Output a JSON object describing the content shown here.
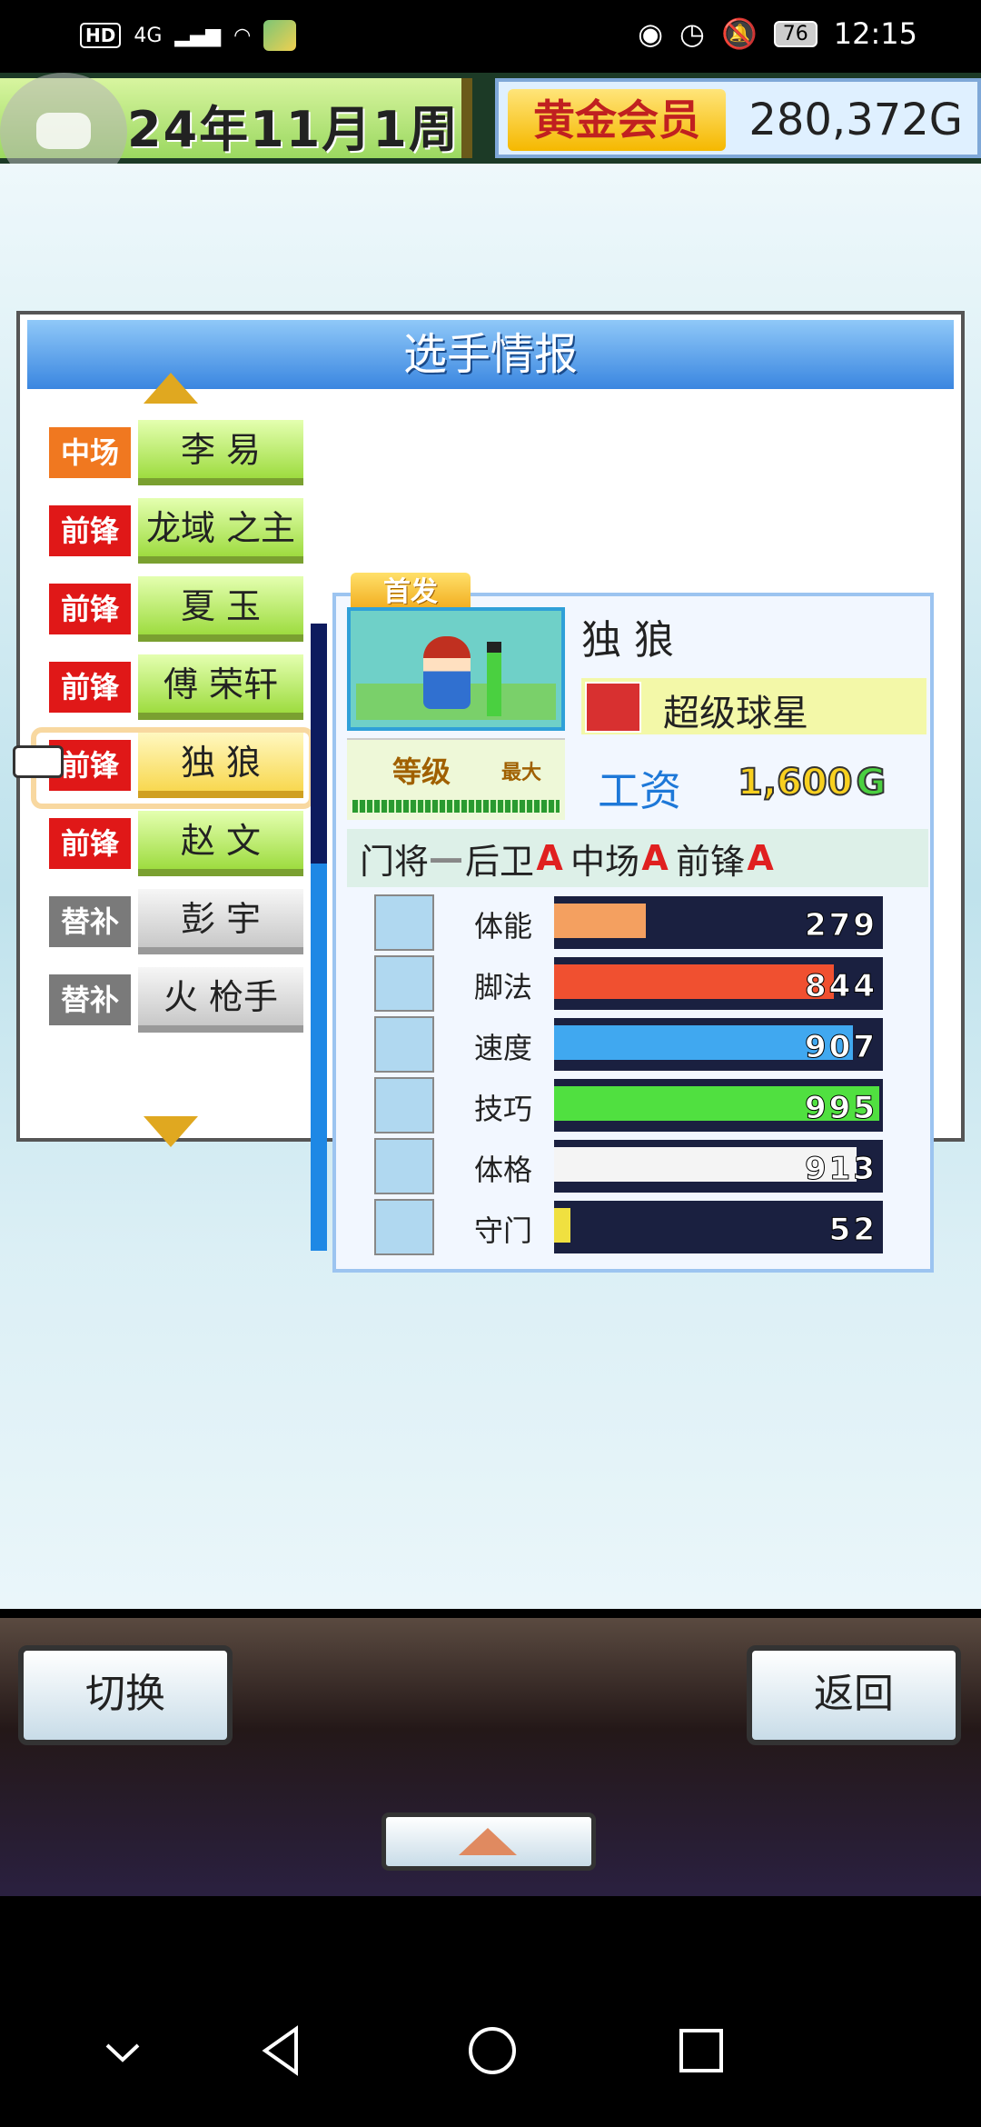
{
  "status_bar": {
    "hd": "HD",
    "network": "4G",
    "time": "12:15",
    "battery": "76"
  },
  "top_bar": {
    "date": "24年11月1周",
    "membership": "黄金会员",
    "gold": "280,372G"
  },
  "panel": {
    "title": "选手情报",
    "roster": [
      {
        "position": "中场",
        "name": "李 易",
        "position_color": "#f07820",
        "kind": "starter"
      },
      {
        "position": "前锋",
        "name": "龙域 之主",
        "position_color": "#e01818",
        "kind": "starter"
      },
      {
        "position": "前锋",
        "name": "夏 玉",
        "position_color": "#e01818",
        "kind": "starter"
      },
      {
        "position": "前锋",
        "name": "傅 荣轩",
        "position_color": "#e01818",
        "kind": "starter"
      },
      {
        "position": "前锋",
        "name": "独 狼",
        "position_color": "#e01818",
        "kind": "selected"
      },
      {
        "position": "前锋",
        "name": "赵 文",
        "position_color": "#e01818",
        "kind": "starter"
      },
      {
        "position": "替补",
        "name": "彭 宇",
        "position_color": "#7a7a7a",
        "kind": "sub"
      },
      {
        "position": "替补",
        "name": "火 枪手",
        "position_color": "#7a7a7a",
        "kind": "sub"
      }
    ]
  },
  "player": {
    "starter_badge": "首发",
    "name": "独 狼",
    "rank": "超级球星",
    "level_label": "等级",
    "level_max": "最大",
    "salary_label": "工资",
    "salary": "1,600",
    "salary_unit": "G",
    "stamina_level": 0.85,
    "position_aptitude": [
      {
        "position": "门将",
        "grade": "—"
      },
      {
        "position": "后卫",
        "grade": "A"
      },
      {
        "position": "中场",
        "grade": "A"
      },
      {
        "position": "前锋",
        "grade": "A"
      }
    ],
    "stats": [
      {
        "label": "体能",
        "value": "279",
        "fraction": 0.28,
        "color": "#f4a060",
        "icon": "battery-icon"
      },
      {
        "label": "脚法",
        "value": "844",
        "fraction": 0.85,
        "color": "#f05030",
        "icon": "boot-icon"
      },
      {
        "label": "速度",
        "value": "907",
        "fraction": 0.91,
        "color": "#40a8f0",
        "icon": "runner-icon"
      },
      {
        "label": "技巧",
        "value": "995",
        "fraction": 0.99,
        "color": "#50e040",
        "icon": "dribble-icon"
      },
      {
        "label": "体格",
        "value": "913",
        "fraction": 0.92,
        "color": "#f4f4f4",
        "icon": "muscle-icon"
      },
      {
        "label": "守门",
        "value": "52",
        "fraction": 0.05,
        "color": "#f0e040",
        "icon": "glove-icon"
      }
    ]
  },
  "controls": {
    "switch_label": "切换",
    "back_label": "返回"
  }
}
